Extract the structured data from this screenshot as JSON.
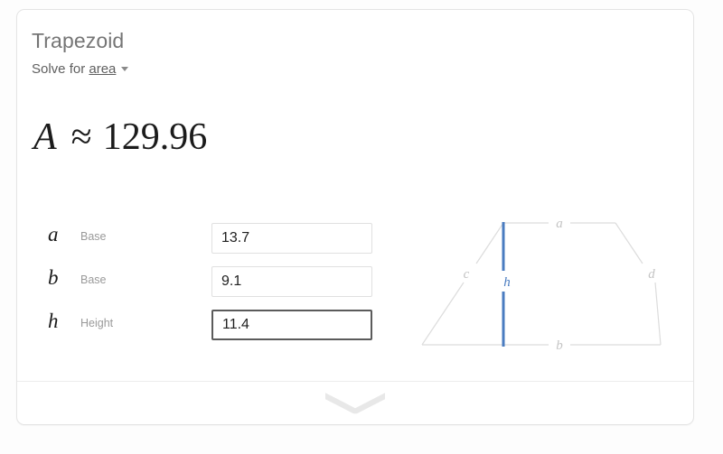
{
  "card": {
    "title": "Trapezoid",
    "solve_prefix": "Solve for",
    "solve_value": "area",
    "caret_icon": "chevron-down-icon"
  },
  "result": {
    "symbol": "A",
    "relation": "≈",
    "value": "129.96"
  },
  "inputs": [
    {
      "symbol": "a",
      "label": "Base",
      "value": "13.7",
      "focused": false
    },
    {
      "symbol": "b",
      "label": "Base",
      "value": "9.1",
      "focused": false
    },
    {
      "symbol": "h",
      "label": "Height",
      "value": "11.4",
      "focused": true
    }
  ],
  "diagram": {
    "name": "trapezoid-diagram",
    "labels": {
      "top": "a",
      "bottom": "b",
      "left": "c",
      "right": "d",
      "height": "h"
    },
    "colors": {
      "outline": "#dcdcdc",
      "height_line": "#4a7cc0",
      "label": "#c4c4c4"
    }
  },
  "footer": {
    "expand_icon": "chevron-down-icon"
  }
}
